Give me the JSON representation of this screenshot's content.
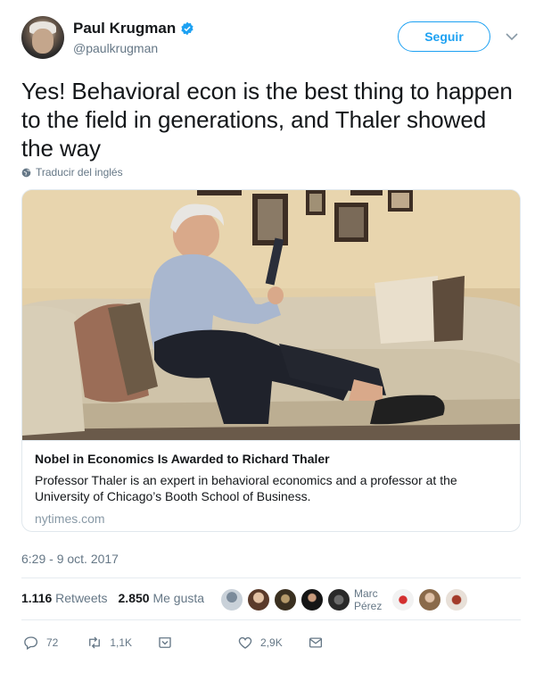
{
  "header": {
    "name": "Paul Krugman",
    "handle": "@paulkrugman",
    "follow_label": "Seguir"
  },
  "tweet": {
    "text": "Yes! Behavioral econ is the best thing to happen to the field in generations, and Thaler showed the way",
    "translate_label": "Traducir del inglés"
  },
  "card": {
    "title": "Nobel in Economics Is Awarded to Richard Thaler",
    "description": "Professor Thaler is an expert in behavioral economics and a professor at the University of Chicago’s Booth School of Business.",
    "domain": "nytimes.com"
  },
  "timestamp": "6:29 - 9 oct. 2017",
  "stats": {
    "retweets_count": "1.116",
    "retweets_label": "Retweets",
    "likes_count": "2.850",
    "likes_label": "Me gusta",
    "liker_name": "Marc Pérez"
  },
  "actions": {
    "replies": "72",
    "retweets": "1,1K",
    "likes": "2,9K"
  },
  "colors": {
    "accent": "#1da1f2",
    "muted": "#657786"
  }
}
